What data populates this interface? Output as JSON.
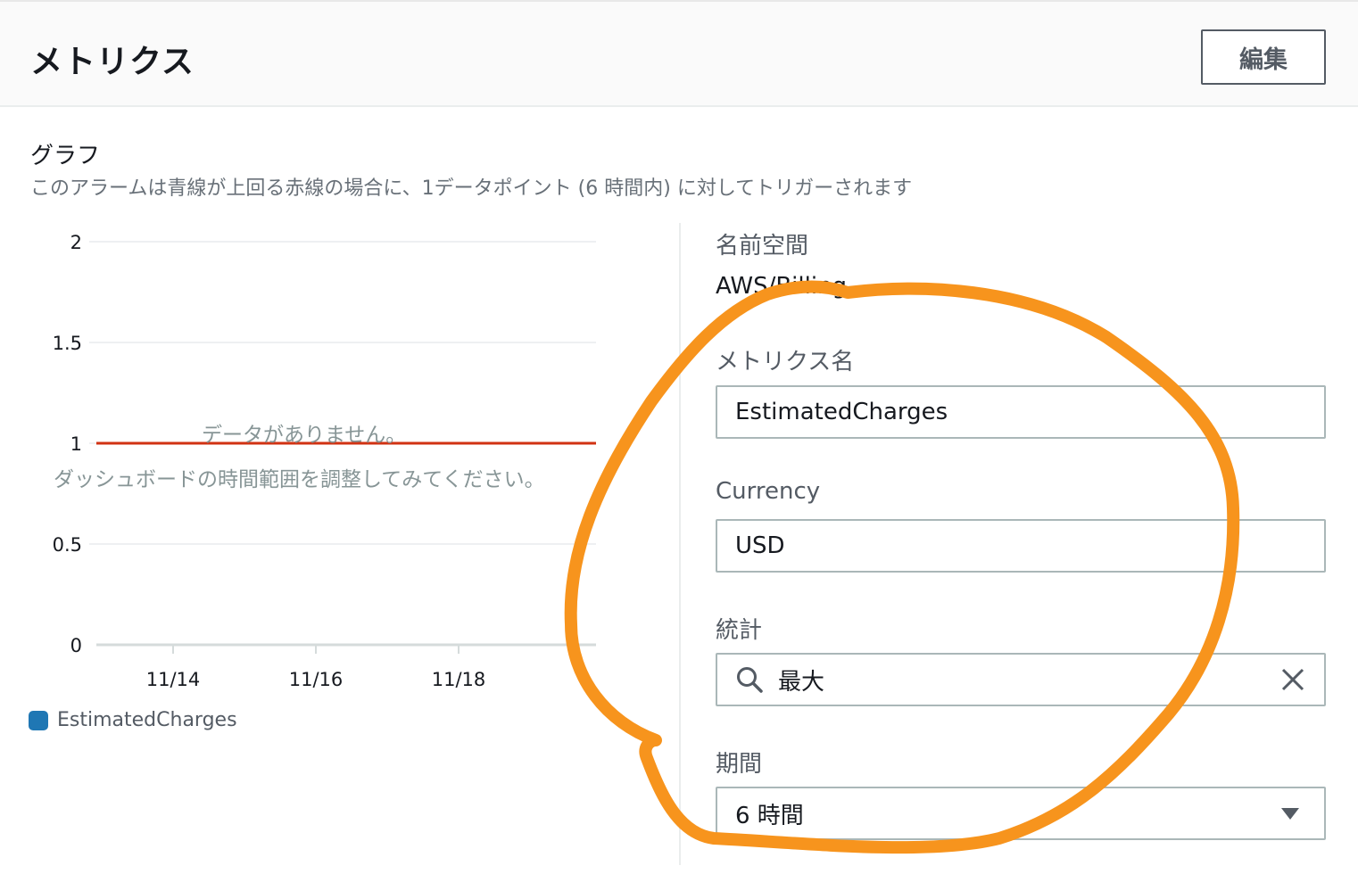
{
  "header": {
    "title": "メトリクス",
    "edit_label": "編集"
  },
  "graph": {
    "title": "グラフ",
    "description": "このアラームは青線が上回る赤線の場合に、1データポイント (6 時間内) に対してトリガーされます",
    "no_data_line1": "データがありません。",
    "no_data_line2": "ダッシュボードの時間範囲を調整してみてください。",
    "legend": "EstimatedCharges",
    "colors": {
      "threshold": "#d13212",
      "series": "#1f77b4"
    }
  },
  "chart_data": {
    "type": "line",
    "title": "",
    "xlabel": "",
    "ylabel": "",
    "ylim": [
      0,
      2
    ],
    "y_ticks": [
      "2",
      "1.5",
      "1",
      "0.5",
      "0"
    ],
    "x_ticks": [
      "11/14",
      "11/16",
      "11/18"
    ],
    "series": [
      {
        "name": "EstimatedCharges",
        "values": []
      }
    ],
    "threshold": 1,
    "grid": true,
    "legend_position": "bottom-left"
  },
  "fields": {
    "namespace_label": "名前空間",
    "namespace_value": "AWS/Billing",
    "metric_name_label": "メトリクス名",
    "metric_name_value": "EstimatedCharges",
    "currency_label": "Currency",
    "currency_value": "USD",
    "statistic_label": "統計",
    "statistic_value": "最大",
    "period_label": "期間",
    "period_value": "6 時間"
  }
}
